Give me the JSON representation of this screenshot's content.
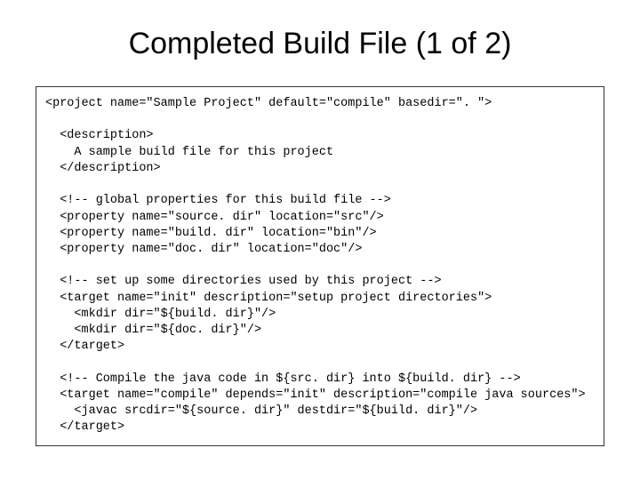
{
  "title": "Completed Build File (1 of 2)",
  "code": "<project name=\"Sample Project\" default=\"compile\" basedir=\". \">\n\n  <description>\n    A sample build file for this project\n  </description>\n\n  <!-- global properties for this build file -->\n  <property name=\"source. dir\" location=\"src\"/>\n  <property name=\"build. dir\" location=\"bin\"/>\n  <property name=\"doc. dir\" location=\"doc\"/>\n\n  <!-- set up some directories used by this project -->\n  <target name=\"init\" description=\"setup project directories\">\n    <mkdir dir=\"${build. dir}\"/>\n    <mkdir dir=\"${doc. dir}\"/>\n  </target>\n\n  <!-- Compile the java code in ${src. dir} into ${build. dir} -->\n  <target name=\"compile\" depends=\"init\" description=\"compile java sources\">\n    <javac srcdir=\"${source. dir}\" destdir=\"${build. dir}\"/>\n  </target>"
}
